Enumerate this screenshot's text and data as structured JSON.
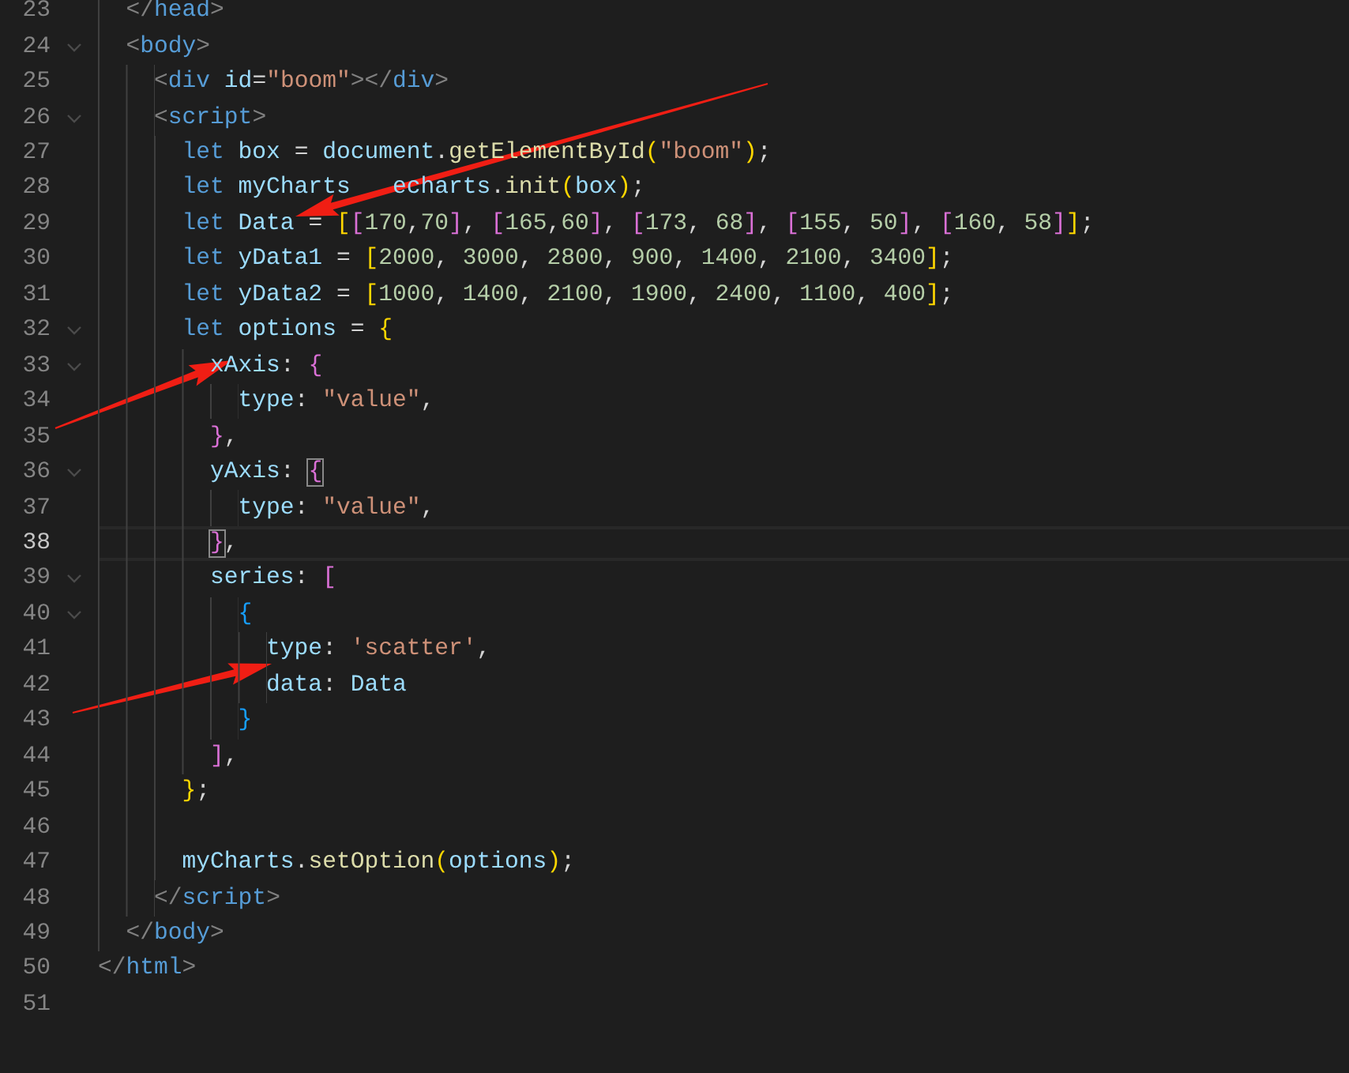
{
  "editor": {
    "lines": [
      {
        "children": [
          {
            "number": "23",
            "foldable": false,
            "current": false,
            "tokens": [
              {
                "kind": "tagpunct",
                "text": "</"
              },
              {
                "kind": "tag",
                "text": "head"
              },
              {
                "kind": "tagpunct",
                "text": ">"
              }
            ]
          },
          {
            "number": "24",
            "foldable": true,
            "current": false,
            "tokens": [
              {
                "kind": "tagpunct",
                "text": "<"
              },
              {
                "kind": "tag",
                "text": "body"
              },
              {
                "kind": "tagpunct",
                "text": ">"
              }
            ],
            "children": [
              {
                "number": "25",
                "foldable": false,
                "current": false,
                "tokens": [
                  {
                    "kind": "tagpunct",
                    "text": "<"
                  },
                  {
                    "kind": "tag",
                    "text": "div"
                  },
                  {
                    "kind": "attr",
                    "text": " id"
                  },
                  {
                    "kind": "punct",
                    "text": "="
                  },
                  {
                    "kind": "string",
                    "text": "\"boom\""
                  },
                  {
                    "kind": "tagpunct",
                    "text": "></"
                  },
                  {
                    "kind": "tag",
                    "text": "div"
                  },
                  {
                    "kind": "tagpunct",
                    "text": ">"
                  }
                ]
              },
              {
                "number": "26",
                "foldable": true,
                "current": false,
                "tokens": [
                  {
                    "kind": "tagpunct",
                    "text": "<"
                  },
                  {
                    "kind": "tag",
                    "text": "script"
                  },
                  {
                    "kind": "tagpunct",
                    "text": ">"
                  }
                ],
                "children": [
                  {
                    "number": "27",
                    "foldable": false,
                    "current": false,
                    "tokens": [
                      {
                        "kind": "keyword",
                        "text": "let"
                      },
                      {
                        "kind": "variable",
                        "text": " box"
                      },
                      {
                        "kind": "punct",
                        "text": " = "
                      },
                      {
                        "kind": "variable",
                        "text": "document"
                      },
                      {
                        "kind": "punct",
                        "text": "."
                      },
                      {
                        "kind": "function",
                        "text": "getElementById"
                      },
                      {
                        "kind": "bracket1",
                        "text": "("
                      },
                      {
                        "kind": "string",
                        "text": "\"boom\""
                      },
                      {
                        "kind": "bracket1",
                        "text": ")"
                      },
                      {
                        "kind": "punct",
                        "text": ";"
                      }
                    ]
                  },
                  {
                    "number": "28",
                    "foldable": false,
                    "current": false,
                    "tokens": [
                      {
                        "kind": "keyword",
                        "text": "let"
                      },
                      {
                        "kind": "variable",
                        "text": " myCharts"
                      },
                      {
                        "kind": "variable",
                        "text": "   echarts"
                      },
                      {
                        "kind": "punct",
                        "text": "."
                      },
                      {
                        "kind": "function",
                        "text": "init"
                      },
                      {
                        "kind": "bracket1",
                        "text": "("
                      },
                      {
                        "kind": "variable",
                        "text": "box"
                      },
                      {
                        "kind": "bracket1",
                        "text": ")"
                      },
                      {
                        "kind": "punct",
                        "text": ";"
                      }
                    ]
                  },
                  {
                    "number": "29",
                    "foldable": false,
                    "current": false,
                    "tokens": [
                      {
                        "kind": "keyword",
                        "text": "let"
                      },
                      {
                        "kind": "variable",
                        "text": " Data"
                      },
                      {
                        "kind": "punct",
                        "text": " = "
                      },
                      {
                        "kind": "bracket1",
                        "text": "["
                      },
                      {
                        "kind": "bracket2",
                        "text": "["
                      },
                      {
                        "kind": "number",
                        "text": "170"
                      },
                      {
                        "kind": "punct",
                        "text": ","
                      },
                      {
                        "kind": "number",
                        "text": "70"
                      },
                      {
                        "kind": "bracket2",
                        "text": "]"
                      },
                      {
                        "kind": "punct",
                        "text": ", "
                      },
                      {
                        "kind": "bracket2",
                        "text": "["
                      },
                      {
                        "kind": "number",
                        "text": "165"
                      },
                      {
                        "kind": "punct",
                        "text": ","
                      },
                      {
                        "kind": "number",
                        "text": "60"
                      },
                      {
                        "kind": "bracket2",
                        "text": "]"
                      },
                      {
                        "kind": "punct",
                        "text": ", "
                      },
                      {
                        "kind": "bracket2",
                        "text": "["
                      },
                      {
                        "kind": "number",
                        "text": "173"
                      },
                      {
                        "kind": "punct",
                        "text": ", "
                      },
                      {
                        "kind": "number",
                        "text": "68"
                      },
                      {
                        "kind": "bracket2",
                        "text": "]"
                      },
                      {
                        "kind": "punct",
                        "text": ", "
                      },
                      {
                        "kind": "bracket2",
                        "text": "["
                      },
                      {
                        "kind": "number",
                        "text": "155"
                      },
                      {
                        "kind": "punct",
                        "text": ", "
                      },
                      {
                        "kind": "number",
                        "text": "50"
                      },
                      {
                        "kind": "bracket2",
                        "text": "]"
                      },
                      {
                        "kind": "punct",
                        "text": ", "
                      },
                      {
                        "kind": "bracket2",
                        "text": "["
                      },
                      {
                        "kind": "number",
                        "text": "160"
                      },
                      {
                        "kind": "punct",
                        "text": ", "
                      },
                      {
                        "kind": "number",
                        "text": "58"
                      },
                      {
                        "kind": "bracket2",
                        "text": "]"
                      },
                      {
                        "kind": "bracket1",
                        "text": "]"
                      },
                      {
                        "kind": "punct",
                        "text": ";"
                      }
                    ]
                  },
                  {
                    "number": "30",
                    "foldable": false,
                    "current": false,
                    "tokens": [
                      {
                        "kind": "keyword",
                        "text": "let"
                      },
                      {
                        "kind": "variable",
                        "text": " yData1"
                      },
                      {
                        "kind": "punct",
                        "text": " = "
                      },
                      {
                        "kind": "bracket1",
                        "text": "["
                      },
                      {
                        "kind": "number",
                        "text": "2000"
                      },
                      {
                        "kind": "punct",
                        "text": ", "
                      },
                      {
                        "kind": "number",
                        "text": "3000"
                      },
                      {
                        "kind": "punct",
                        "text": ", "
                      },
                      {
                        "kind": "number",
                        "text": "2800"
                      },
                      {
                        "kind": "punct",
                        "text": ", "
                      },
                      {
                        "kind": "number",
                        "text": "900"
                      },
                      {
                        "kind": "punct",
                        "text": ", "
                      },
                      {
                        "kind": "number",
                        "text": "1400"
                      },
                      {
                        "kind": "punct",
                        "text": ", "
                      },
                      {
                        "kind": "number",
                        "text": "2100"
                      },
                      {
                        "kind": "punct",
                        "text": ", "
                      },
                      {
                        "kind": "number",
                        "text": "3400"
                      },
                      {
                        "kind": "bracket1",
                        "text": "]"
                      },
                      {
                        "kind": "punct",
                        "text": ";"
                      }
                    ]
                  },
                  {
                    "number": "31",
                    "foldable": false,
                    "current": false,
                    "tokens": [
                      {
                        "kind": "keyword",
                        "text": "let"
                      },
                      {
                        "kind": "variable",
                        "text": " yData2"
                      },
                      {
                        "kind": "punct",
                        "text": " = "
                      },
                      {
                        "kind": "bracket1",
                        "text": "["
                      },
                      {
                        "kind": "number",
                        "text": "1000"
                      },
                      {
                        "kind": "punct",
                        "text": ", "
                      },
                      {
                        "kind": "number",
                        "text": "1400"
                      },
                      {
                        "kind": "punct",
                        "text": ", "
                      },
                      {
                        "kind": "number",
                        "text": "2100"
                      },
                      {
                        "kind": "punct",
                        "text": ", "
                      },
                      {
                        "kind": "number",
                        "text": "1900"
                      },
                      {
                        "kind": "punct",
                        "text": ", "
                      },
                      {
                        "kind": "number",
                        "text": "2400"
                      },
                      {
                        "kind": "punct",
                        "text": ", "
                      },
                      {
                        "kind": "number",
                        "text": "1100"
                      },
                      {
                        "kind": "punct",
                        "text": ", "
                      },
                      {
                        "kind": "number",
                        "text": "400"
                      },
                      {
                        "kind": "bracket1",
                        "text": "]"
                      },
                      {
                        "kind": "punct",
                        "text": ";"
                      }
                    ]
                  },
                  {
                    "number": "32",
                    "foldable": true,
                    "current": false,
                    "tokens": [
                      {
                        "kind": "keyword",
                        "text": "let"
                      },
                      {
                        "kind": "variable",
                        "text": " options"
                      },
                      {
                        "kind": "punct",
                        "text": " = "
                      },
                      {
                        "kind": "bracket1",
                        "text": "{"
                      }
                    ],
                    "children": [
                      {
                        "number": "33",
                        "foldable": true,
                        "current": false,
                        "tokens": [
                          {
                            "kind": "variable",
                            "text": "xAxis"
                          },
                          {
                            "kind": "punct",
                            "text": ": "
                          },
                          {
                            "kind": "bracket2",
                            "text": "{"
                          }
                        ],
                        "children": [
                          {
                            "number": "34",
                            "foldable": false,
                            "current": false,
                            "tokens": [
                              {
                                "kind": "variable",
                                "text": "type"
                              },
                              {
                                "kind": "punct",
                                "text": ": "
                              },
                              {
                                "kind": "string",
                                "text": "\"value\""
                              },
                              {
                                "kind": "punct",
                                "text": ","
                              }
                            ]
                          }
                        ]
                      },
                      {
                        "number": "35",
                        "foldable": false,
                        "current": false,
                        "tokens": [
                          {
                            "kind": "bracket2",
                            "text": "}"
                          },
                          {
                            "kind": "punct",
                            "text": ","
                          }
                        ]
                      },
                      {
                        "number": "36",
                        "foldable": true,
                        "current": false,
                        "tokens": [
                          {
                            "kind": "variable",
                            "text": "yAxis"
                          },
                          {
                            "kind": "punct",
                            "text": ": "
                          },
                          {
                            "kind": "bracket2",
                            "text": "{",
                            "matched": true
                          }
                        ],
                        "children": [
                          {
                            "number": "37",
                            "foldable": false,
                            "current": false,
                            "tokens": [
                              {
                                "kind": "variable",
                                "text": "type"
                              },
                              {
                                "kind": "punct",
                                "text": ": "
                              },
                              {
                                "kind": "string",
                                "text": "\"value\""
                              },
                              {
                                "kind": "punct",
                                "text": ","
                              }
                            ]
                          }
                        ]
                      },
                      {
                        "number": "38",
                        "foldable": false,
                        "current": true,
                        "tokens": [
                          {
                            "kind": "bracket2",
                            "text": "}",
                            "matched": true
                          },
                          {
                            "kind": "punct",
                            "text": ","
                          }
                        ]
                      },
                      {
                        "number": "39",
                        "foldable": true,
                        "current": false,
                        "tokens": [
                          {
                            "kind": "variable",
                            "text": "series"
                          },
                          {
                            "kind": "punct",
                            "text": ": "
                          },
                          {
                            "kind": "bracket2",
                            "text": "["
                          }
                        ],
                        "children": [
                          {
                            "number": "40",
                            "foldable": true,
                            "current": false,
                            "tokens": [
                              {
                                "kind": "bracket3",
                                "text": "{"
                              }
                            ],
                            "children": [
                              {
                                "number": "41",
                                "foldable": false,
                                "current": false,
                                "tokens": [
                                  {
                                    "kind": "variable",
                                    "text": "type"
                                  },
                                  {
                                    "kind": "punct",
                                    "text": ": "
                                  },
                                  {
                                    "kind": "string",
                                    "text": "'scatter'"
                                  },
                                  {
                                    "kind": "punct",
                                    "text": ","
                                  }
                                ]
                              },
                              {
                                "number": "42",
                                "foldable": false,
                                "current": false,
                                "tokens": [
                                  {
                                    "kind": "variable",
                                    "text": "data"
                                  },
                                  {
                                    "kind": "punct",
                                    "text": ": "
                                  },
                                  {
                                    "kind": "variable",
                                    "text": "Data"
                                  }
                                ]
                              }
                            ]
                          },
                          {
                            "number": "43",
                            "foldable": false,
                            "current": false,
                            "tokens": [
                              {
                                "kind": "bracket3",
                                "text": "}"
                              }
                            ]
                          }
                        ]
                      },
                      {
                        "number": "44",
                        "foldable": false,
                        "current": false,
                        "tokens": [
                          {
                            "kind": "bracket2",
                            "text": "]"
                          },
                          {
                            "kind": "punct",
                            "text": ","
                          }
                        ]
                      }
                    ]
                  },
                  {
                    "number": "45",
                    "foldable": false,
                    "current": false,
                    "tokens": [
                      {
                        "kind": "bracket1",
                        "text": "}"
                      },
                      {
                        "kind": "punct",
                        "text": ";"
                      }
                    ]
                  },
                  {
                    "number": "46",
                    "foldable": false,
                    "current": false
                  },
                  {
                    "number": "47",
                    "foldable": false,
                    "current": false,
                    "tokens": [
                      {
                        "kind": "variable",
                        "text": "myCharts"
                      },
                      {
                        "kind": "punct",
                        "text": "."
                      },
                      {
                        "kind": "function",
                        "text": "setOption"
                      },
                      {
                        "kind": "bracket1",
                        "text": "("
                      },
                      {
                        "kind": "variable",
                        "text": "options"
                      },
                      {
                        "kind": "bracket1",
                        "text": ")"
                      },
                      {
                        "kind": "punct",
                        "text": ";"
                      }
                    ]
                  }
                ]
              },
              {
                "number": "48",
                "foldable": false,
                "current": false,
                "tokens": [
                  {
                    "kind": "tagpunct",
                    "text": "</"
                  },
                  {
                    "kind": "tag",
                    "text": "script"
                  },
                  {
                    "kind": "tagpunct",
                    "text": ">"
                  }
                ]
              }
            ]
          },
          {
            "number": "49",
            "foldable": false,
            "current": false,
            "tokens": [
              {
                "kind": "tagpunct",
                "text": "</"
              },
              {
                "kind": "tag",
                "text": "body"
              },
              {
                "kind": "tagpunct",
                "text": ">"
              }
            ]
          }
        ]
      },
      {
        "number": "50",
        "foldable": false,
        "current": false,
        "tokens": [
          {
            "kind": "tagpunct",
            "text": "</"
          },
          {
            "kind": "tag",
            "text": "html"
          },
          {
            "kind": "tagpunct",
            "text": ">"
          }
        ]
      },
      {
        "number": "51",
        "foldable": false,
        "current": false
      }
    ]
  },
  "annotations": [
    {
      "kind": "arrow"
    },
    {
      "kind": "arrow"
    },
    {
      "kind": "arrow"
    }
  ]
}
